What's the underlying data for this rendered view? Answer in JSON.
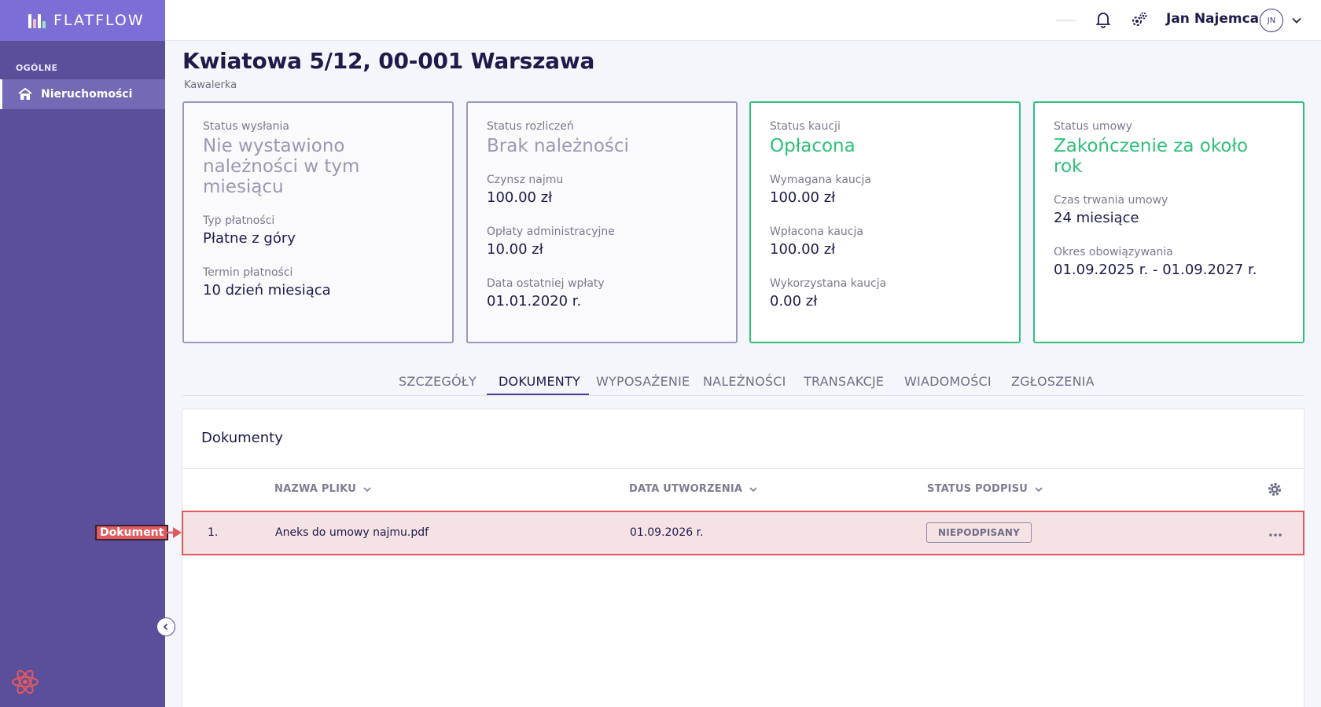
{
  "brand": {
    "name": "FLATFLOW"
  },
  "sidebar": {
    "section_label": "OGÓLNE",
    "items": [
      {
        "label": "Nieruchomości",
        "icon": "home-icon",
        "active": true
      }
    ]
  },
  "topbar": {
    "user_name": "Jan Najemca",
    "avatar_initials": "JN",
    "icons": [
      "bell-icon",
      "gears-icon",
      "chevron-down-icon"
    ]
  },
  "page": {
    "title": "Kwiatowa 5/12, 00-001 Warszawa",
    "subtitle": "Kawalerka"
  },
  "cards": [
    {
      "label": "Status wysłania",
      "status": "Nie wystawiono należności w tym miesiącu",
      "fields": [
        {
          "label": "Typ płatności",
          "value": "Płatne z góry"
        },
        {
          "label": "Termin płatności",
          "value": "10 dzień miesiąca"
        }
      ]
    },
    {
      "label": "Status rozliczeń",
      "status": "Brak należności",
      "fields": [
        {
          "label": "Czynsz najmu",
          "value": "100.00 zł"
        },
        {
          "label": "Opłaty administracyjne",
          "value": "10.00 zł"
        },
        {
          "label": "Data ostatniej wpłaty",
          "value": "01.01.2020 r."
        }
      ]
    },
    {
      "label": "Status kaucji",
      "status": "Opłacona",
      "fields": [
        {
          "label": "Wymagana kaucja",
          "value": "100.00 zł"
        },
        {
          "label": "Wpłacona kaucja",
          "value": "100.00 zł"
        },
        {
          "label": "Wykorzystana kaucja",
          "value": "0.00 zł"
        }
      ]
    },
    {
      "label": "Status umowy",
      "status": "Zakończenie za około rok",
      "fields": [
        {
          "label": "Czas trwania umowy",
          "value": "24 miesiące"
        },
        {
          "label": "Okres obowiązywania",
          "value": "01.09.2025 r. - 01.09.2027 r."
        }
      ]
    }
  ],
  "tabs": [
    {
      "label": "SZCZEGÓŁY"
    },
    {
      "label": "DOKUMENTY",
      "active": true
    },
    {
      "label": "WYPOSAŻENIE"
    },
    {
      "label": "NALEŻNOŚCI"
    },
    {
      "label": "TRANSAKCJE"
    },
    {
      "label": "WIADOMOŚCI"
    },
    {
      "label": "ZGŁOSZENIA"
    }
  ],
  "documents": {
    "title": "Dokumenty",
    "columns": [
      "NAZWA PLIKU",
      "DATA UTWORZENIA",
      "STATUS PODPISU"
    ],
    "rows": [
      {
        "index": "1.",
        "file_name": "Aneks do umowy najmu.pdf",
        "created": "01.09.2026 r.",
        "status": "NIEPODPISANY"
      }
    ]
  },
  "annotation": {
    "label": "Dokument"
  },
  "colors": {
    "sidebar": "#5b4e9a",
    "brand": "#7b6ed6",
    "success": "#2fc07a",
    "highlight": "#e05a5e"
  }
}
